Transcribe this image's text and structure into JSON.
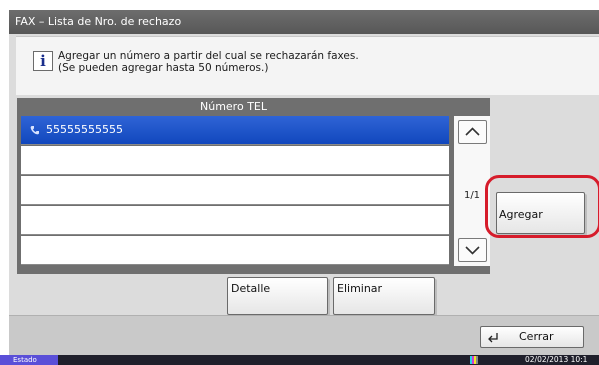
{
  "window": {
    "title": "FAX – Lista de Nro. de rechazo"
  },
  "info": {
    "icon": "info-icon",
    "line1": "Agregar un número a partir del cual se rechazarán faxes.",
    "line2": "(Se pueden agregar hasta 50 números.)"
  },
  "list": {
    "header": "Número TEL",
    "rows": [
      {
        "label": "55555555555",
        "icon": "phone-icon",
        "selected": true
      },
      {
        "label": ""
      },
      {
        "label": ""
      },
      {
        "label": ""
      },
      {
        "label": ""
      }
    ],
    "page": "1/1"
  },
  "buttons": {
    "add": "Agregar",
    "detail": "Detalle",
    "delete": "Eliminar",
    "close": "Cerrar"
  },
  "status": {
    "estado": "Estado",
    "datetime": "02/02/2013  10:1"
  },
  "colors": {
    "selection": "#1a52c8",
    "highlight": "#d61c2b",
    "status_badge": "#5a4fd8"
  }
}
